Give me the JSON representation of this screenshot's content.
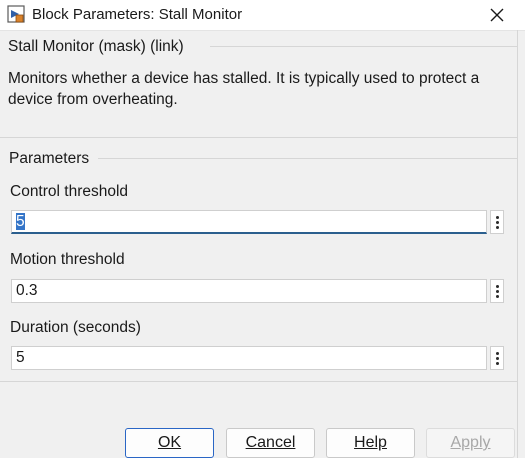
{
  "window": {
    "title": "Block Parameters: Stall Monitor",
    "icon": "simulink-block-icon",
    "close_icon": "close-icon"
  },
  "mask": {
    "header": "Stall Monitor (mask) (link)",
    "description": "Monitors whether a device has stalled. It is typically used to protect a device from overheating."
  },
  "parameters": {
    "header": "Parameters",
    "fields": [
      {
        "label": "Control threshold",
        "value": "5"
      },
      {
        "label": "Motion threshold",
        "value": "0.3"
      },
      {
        "label": "Duration (seconds)",
        "value": "5"
      }
    ]
  },
  "buttons": {
    "ok": "OK",
    "cancel": "Cancel",
    "help": "Help",
    "apply": "Apply"
  },
  "colors": {
    "selection": "#3475c8",
    "primary_border": "#2a66c5"
  }
}
